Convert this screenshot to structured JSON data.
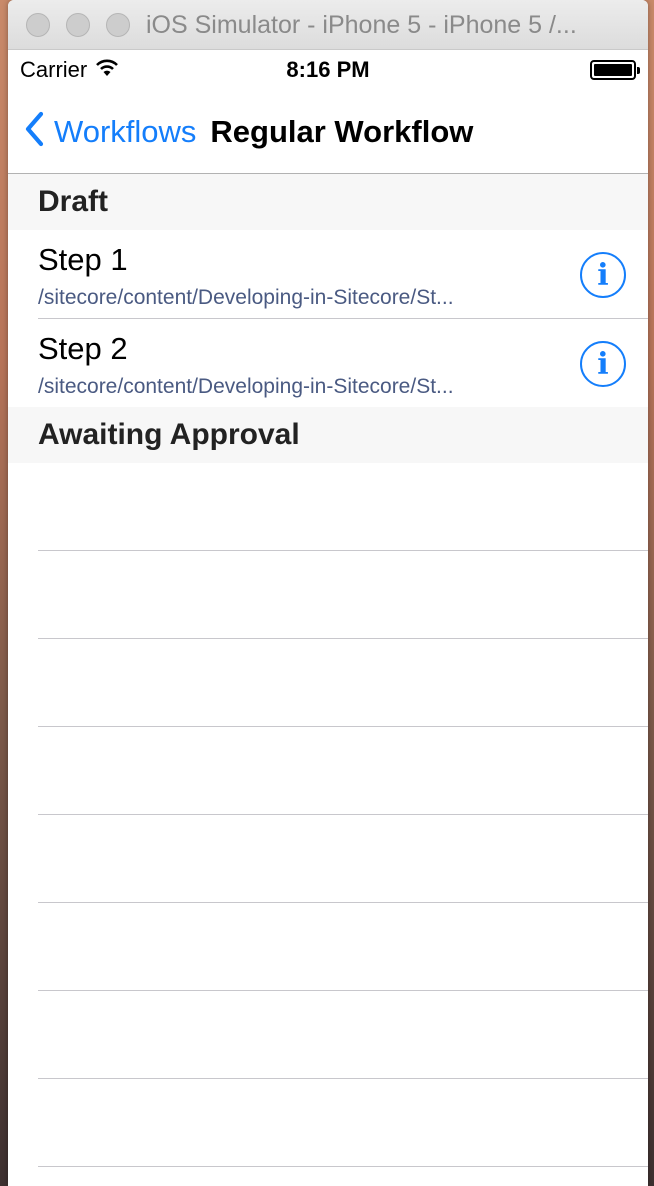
{
  "window": {
    "title": "iOS Simulator - iPhone 5 - iPhone 5 /..."
  },
  "status": {
    "carrier": "Carrier",
    "time": "8:16 PM"
  },
  "nav": {
    "back_label": "Workflows",
    "title": "Regular Workflow"
  },
  "sections": [
    {
      "header": "Draft",
      "rows": [
        {
          "title": "Step 1",
          "subtitle": "/sitecore/content/Developing-in-Sitecore/St..."
        },
        {
          "title": "Step 2",
          "subtitle": "/sitecore/content/Developing-in-Sitecore/St..."
        }
      ]
    },
    {
      "header": "Awaiting Approval",
      "rows": []
    }
  ],
  "colors": {
    "accent": "#147efb",
    "subtitle": "#4a5a82",
    "section_bg": "#f7f7f7"
  }
}
